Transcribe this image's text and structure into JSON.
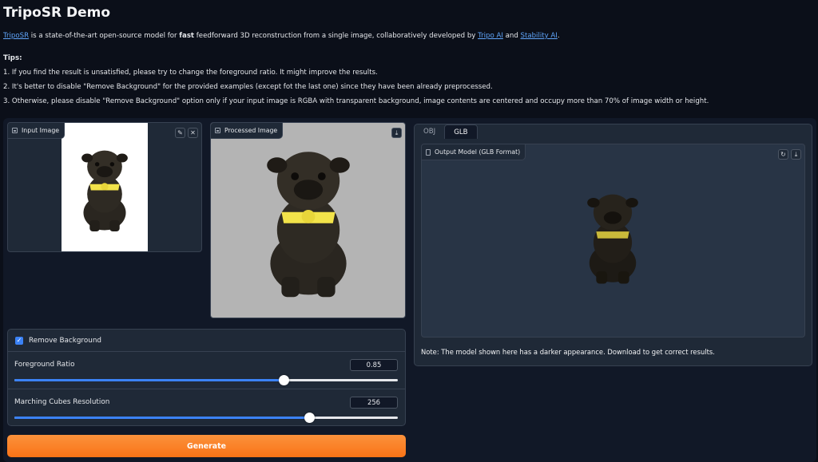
{
  "page": {
    "title": "TripoSR Demo",
    "intro": {
      "link_triposr": "TripoSR",
      "text1": " is a state-of-the-art open-source model for ",
      "bold": "fast",
      "text2": " feedforward 3D reconstruction from a single image, collaboratively developed by ",
      "link_tripo": "Tripo AI",
      "text3": " and ",
      "link_stability": "Stability AI",
      "text4": "."
    },
    "tips_heading": "Tips:",
    "tips": [
      "1. If you find the result is unsatisfied, please try to change the foreground ratio. It might improve the results.",
      "2. It's better to disable \"Remove Background\" for the provided examples (except fot the last one) since they have been already preprocessed.",
      "3. Otherwise, please disable \"Remove Background\" option only if your input image is RGBA with transparent background, image contents are centered and occupy more than 70% of image width or height."
    ]
  },
  "input_image": {
    "label": "Input Image",
    "edit_icon": "pencil-icon",
    "clear_icon": "close-icon"
  },
  "processed_image": {
    "label": "Processed Image",
    "download_icon": "download-icon"
  },
  "controls": {
    "remove_background": {
      "label": "Remove Background",
      "checked": true,
      "check_glyph": "✓"
    },
    "foreground_ratio": {
      "label": "Foreground Ratio",
      "value": "0.85",
      "fraction": 0.703
    },
    "mc_resolution": {
      "label": "Marching Cubes Resolution",
      "value": "256",
      "fraction": 0.769
    }
  },
  "generate_button": {
    "label": "Generate",
    "color": "#f97316"
  },
  "output": {
    "tabs": [
      {
        "label": "OBJ",
        "active": false
      },
      {
        "label": "GLB",
        "active": true
      }
    ],
    "label": "Output Model (GLB Format)",
    "reset_icon": "refresh-icon",
    "download_icon": "download-icon",
    "note": "Note: The model shown here has a darker appearance. Download to get correct results."
  },
  "colors": {
    "accent": "#3b82f6",
    "bg": "#0b0f19",
    "panel": "#1f2937",
    "link": "#60a5fa"
  }
}
